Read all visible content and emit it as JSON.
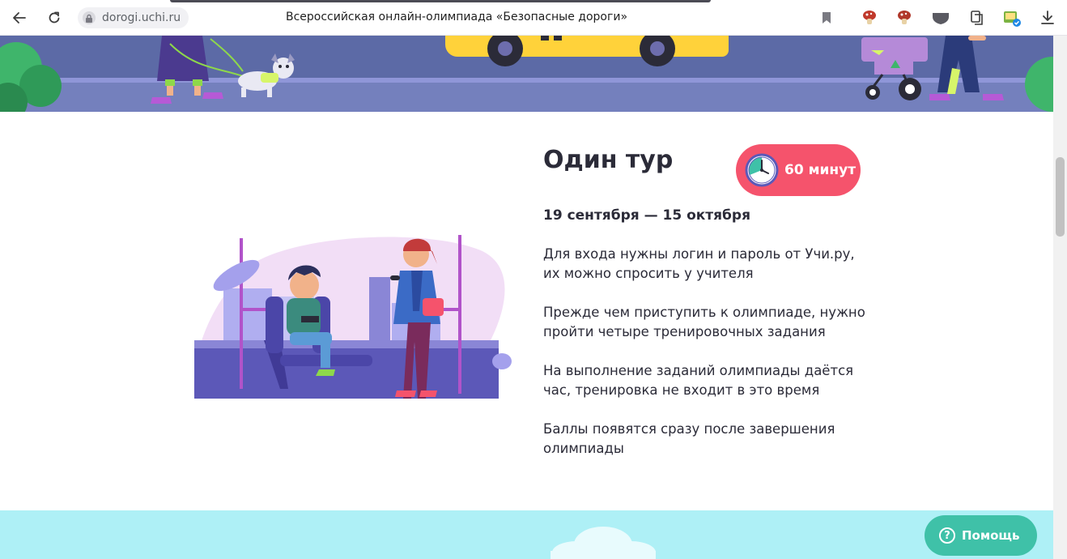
{
  "browser": {
    "url": "dorogi.uchi.ru",
    "page_title": "Всероссийская онлайн-олимпиада «Безопасные дороги»"
  },
  "section": {
    "title": "Один тур",
    "timer": "60 минут",
    "dates": "19 сентября — 15 октября",
    "paragraphs": [
      "Для входа нужны логин и пароль от Учи.ру,\nих можно спросить у учителя",
      "Прежде чем приступить к олимпиаде, нужно\nпройти четыре тренировочных задания",
      "На выполнение заданий олимпиады даётся\nчас, тренировка не входит в это время",
      "Баллы появятся сразу после завершения\nолимпиады"
    ]
  },
  "help_button": {
    "label": "Помощь"
  },
  "colors": {
    "accent_pink": "#f5536c",
    "help_green": "#3fc1a8",
    "hero_blue": "#5c6aa6",
    "band_cyan": "#aef0f6",
    "text_dark": "#2b2b38"
  },
  "icons": {
    "back": "back-arrow-icon",
    "reload": "reload-icon",
    "lock": "lock-icon",
    "bookmark": "bookmark-icon",
    "timer": "stopwatch-icon",
    "help": "question-icon",
    "download": "download-icon"
  }
}
